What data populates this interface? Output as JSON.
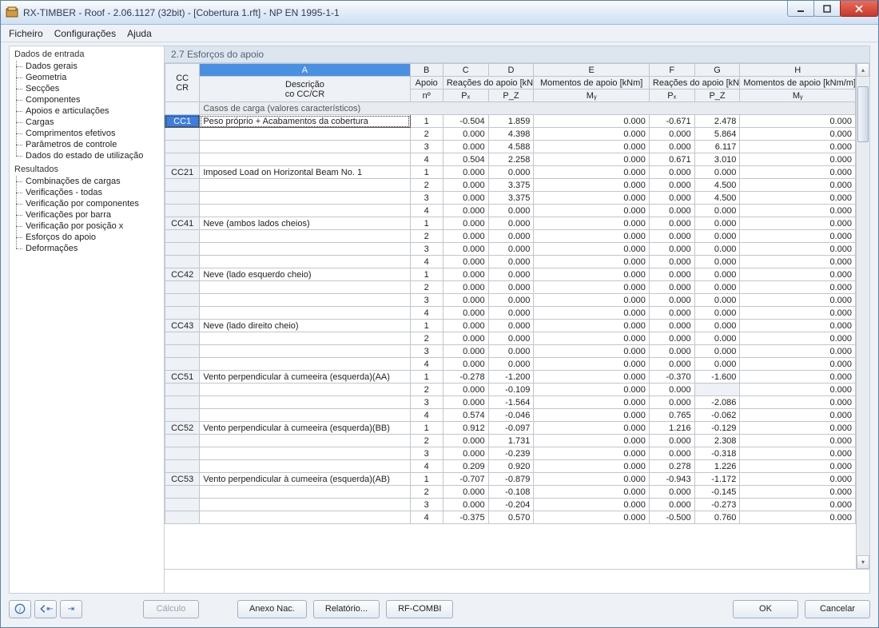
{
  "window": {
    "title": "RX-TIMBER - Roof - 2.06.1127 (32bit) - [Cobertura 1.rft] - NP EN 1995-1-1"
  },
  "menu": [
    "Ficheiro",
    "Configurações",
    "Ajuda"
  ],
  "nav": {
    "input": {
      "title": "Dados de entrada",
      "items": [
        "Dados gerais",
        "Geometria",
        "Secções",
        "Componentes",
        "Apoios e articulações",
        "Cargas",
        "Comprimentos efetivos",
        "Parâmetros de controle",
        "Dados do estado de utilização"
      ]
    },
    "results": {
      "title": "Resultados",
      "items": [
        "Combinações de cargas",
        "Verificações - todas",
        "Verificação por componentes",
        "Verificações por barra",
        "Verificação por posição x",
        "Esforços do apoio",
        "Deformações"
      ]
    }
  },
  "section": {
    "title": "2.7 Esforços do apoio"
  },
  "table": {
    "letters": [
      "A",
      "B",
      "C",
      "D",
      "E",
      "F",
      "G",
      "H"
    ],
    "head": {
      "cc1": "CC",
      "cc2": "CR",
      "desc1": "Descrição",
      "desc2": "co CC/CR",
      "apoio": "Apoio",
      "no": "nº",
      "reac_kn": "Reações do apoio [kN]",
      "mom_knm": "Momentos de apoio [kNm]",
      "reac_knm": "Reações do apoio [kN/m]",
      "mom_knmm": "Momentos de apoio [kNm/m]",
      "px": "Pₓ",
      "pz": "P_Z",
      "my": "Mᵧ"
    },
    "section_header": "Casos de carga (valores característicos)",
    "groups": [
      {
        "cc": "CC1",
        "desc": "Peso próprio + Acabamentos da cobertura",
        "selected": true,
        "rows": [
          {
            "n": "1",
            "px": "-0.504",
            "pz": "1.859",
            "my": "0.000",
            "px2": "-0.671",
            "pz2": "2.478",
            "my2": "0.000"
          },
          {
            "n": "2",
            "px": "0.000",
            "pz": "4.398",
            "my": "0.000",
            "px2": "0.000",
            "pz2": "5.864",
            "my2": "0.000"
          },
          {
            "n": "3",
            "px": "0.000",
            "pz": "4.588",
            "my": "0.000",
            "px2": "0.000",
            "pz2": "6.117",
            "my2": "0.000"
          },
          {
            "n": "4",
            "px": "0.504",
            "pz": "2.258",
            "my": "0.000",
            "px2": "0.671",
            "pz2": "3.010",
            "my2": "0.000"
          }
        ]
      },
      {
        "cc": "CC21",
        "desc": "Imposed Load on Horizontal Beam No. 1",
        "rows": [
          {
            "n": "1",
            "px": "0.000",
            "pz": "0.000",
            "my": "0.000",
            "px2": "0.000",
            "pz2": "0.000",
            "my2": "0.000"
          },
          {
            "n": "2",
            "px": "0.000",
            "pz": "3.375",
            "my": "0.000",
            "px2": "0.000",
            "pz2": "4.500",
            "my2": "0.000"
          },
          {
            "n": "3",
            "px": "0.000",
            "pz": "3.375",
            "my": "0.000",
            "px2": "0.000",
            "pz2": "4.500",
            "my2": "0.000"
          },
          {
            "n": "4",
            "px": "0.000",
            "pz": "0.000",
            "my": "0.000",
            "px2": "0.000",
            "pz2": "0.000",
            "my2": "0.000"
          }
        ]
      },
      {
        "cc": "CC41",
        "desc": "Neve (ambos lados cheios)",
        "rows": [
          {
            "n": "1",
            "px": "0.000",
            "pz": "0.000",
            "my": "0.000",
            "px2": "0.000",
            "pz2": "0.000",
            "my2": "0.000"
          },
          {
            "n": "2",
            "px": "0.000",
            "pz": "0.000",
            "my": "0.000",
            "px2": "0.000",
            "pz2": "0.000",
            "my2": "0.000"
          },
          {
            "n": "3",
            "px": "0.000",
            "pz": "0.000",
            "my": "0.000",
            "px2": "0.000",
            "pz2": "0.000",
            "my2": "0.000"
          },
          {
            "n": "4",
            "px": "0.000",
            "pz": "0.000",
            "my": "0.000",
            "px2": "0.000",
            "pz2": "0.000",
            "my2": "0.000"
          }
        ]
      },
      {
        "cc": "CC42",
        "desc": "Neve (lado esquerdo cheio)",
        "rows": [
          {
            "n": "1",
            "px": "0.000",
            "pz": "0.000",
            "my": "0.000",
            "px2": "0.000",
            "pz2": "0.000",
            "my2": "0.000"
          },
          {
            "n": "2",
            "px": "0.000",
            "pz": "0.000",
            "my": "0.000",
            "px2": "0.000",
            "pz2": "0.000",
            "my2": "0.000"
          },
          {
            "n": "3",
            "px": "0.000",
            "pz": "0.000",
            "my": "0.000",
            "px2": "0.000",
            "pz2": "0.000",
            "my2": "0.000"
          },
          {
            "n": "4",
            "px": "0.000",
            "pz": "0.000",
            "my": "0.000",
            "px2": "0.000",
            "pz2": "0.000",
            "my2": "0.000"
          }
        ]
      },
      {
        "cc": "CC43",
        "desc": "Neve (lado direito cheio)",
        "rows": [
          {
            "n": "1",
            "px": "0.000",
            "pz": "0.000",
            "my": "0.000",
            "px2": "0.000",
            "pz2": "0.000",
            "my2": "0.000"
          },
          {
            "n": "2",
            "px": "0.000",
            "pz": "0.000",
            "my": "0.000",
            "px2": "0.000",
            "pz2": "0.000",
            "my2": "0.000"
          },
          {
            "n": "3",
            "px": "0.000",
            "pz": "0.000",
            "my": "0.000",
            "px2": "0.000",
            "pz2": "0.000",
            "my2": "0.000"
          },
          {
            "n": "4",
            "px": "0.000",
            "pz": "0.000",
            "my": "0.000",
            "px2": "0.000",
            "pz2": "0.000",
            "my2": "0.000"
          }
        ]
      },
      {
        "cc": "CC51",
        "desc": "Vento perpendicular à cumeeira (esquerda)(AA)",
        "rows": [
          {
            "n": "1",
            "px": "-0.278",
            "pz": "-1.200",
            "my": "0.000",
            "px2": "-0.370",
            "pz2": "-1.600",
            "my2": "0.000"
          },
          {
            "n": "2",
            "px": "0.000",
            "pz": "-0.109",
            "my": "0.000",
            "px2": "0.000",
            "pz2": "",
            "pz2shade": true,
            "my2": "0.000"
          },
          {
            "n": "3",
            "px": "0.000",
            "pz": "-1.564",
            "my": "0.000",
            "px2": "0.000",
            "pz2": "-2.086",
            "my2": "0.000"
          },
          {
            "n": "4",
            "px": "0.574",
            "pz": "-0.046",
            "my": "0.000",
            "px2": "0.765",
            "pz2": "-0.062",
            "my2": "0.000"
          }
        ]
      },
      {
        "cc": "CC52",
        "desc": "Vento perpendicular à cumeeira (esquerda)(BB)",
        "rows": [
          {
            "n": "1",
            "px": "0.912",
            "pz": "-0.097",
            "my": "0.000",
            "px2": "1.216",
            "pz2": "-0.129",
            "my2": "0.000"
          },
          {
            "n": "2",
            "px": "0.000",
            "pz": "1.731",
            "my": "0.000",
            "px2": "0.000",
            "pz2": "2.308",
            "my2": "0.000"
          },
          {
            "n": "3",
            "px": "0.000",
            "pz": "-0.239",
            "my": "0.000",
            "px2": "0.000",
            "pz2": "-0.318",
            "my2": "0.000"
          },
          {
            "n": "4",
            "px": "0.209",
            "pz": "0.920",
            "my": "0.000",
            "px2": "0.278",
            "pz2": "1.226",
            "my2": "0.000"
          }
        ]
      },
      {
        "cc": "CC53",
        "desc": "Vento perpendicular à cumeeira (esquerda)(AB)",
        "rows": [
          {
            "n": "1",
            "px": "-0.707",
            "pz": "-0.879",
            "my": "0.000",
            "px2": "-0.943",
            "pz2": "-1.172",
            "my2": "0.000"
          },
          {
            "n": "2",
            "px": "0.000",
            "pz": "-0.108",
            "my": "0.000",
            "px2": "0.000",
            "pz2": "-0.145",
            "my2": "0.000"
          },
          {
            "n": "3",
            "px": "0.000",
            "pz": "-0.204",
            "my": "0.000",
            "px2": "0.000",
            "pz2": "-0.273",
            "my2": "0.000"
          },
          {
            "n": "4",
            "px": "-0.375",
            "pz": "0.570",
            "my": "0.000",
            "px2": "-0.500",
            "pz2": "0.760",
            "my2": "0.000"
          }
        ]
      }
    ]
  },
  "footer": {
    "calculo": "Cálculo",
    "anexo": "Anexo Nac.",
    "relatorio": "Relatório...",
    "rfcombi": "RF-COMBI",
    "ok": "OK",
    "cancel": "Cancelar"
  }
}
